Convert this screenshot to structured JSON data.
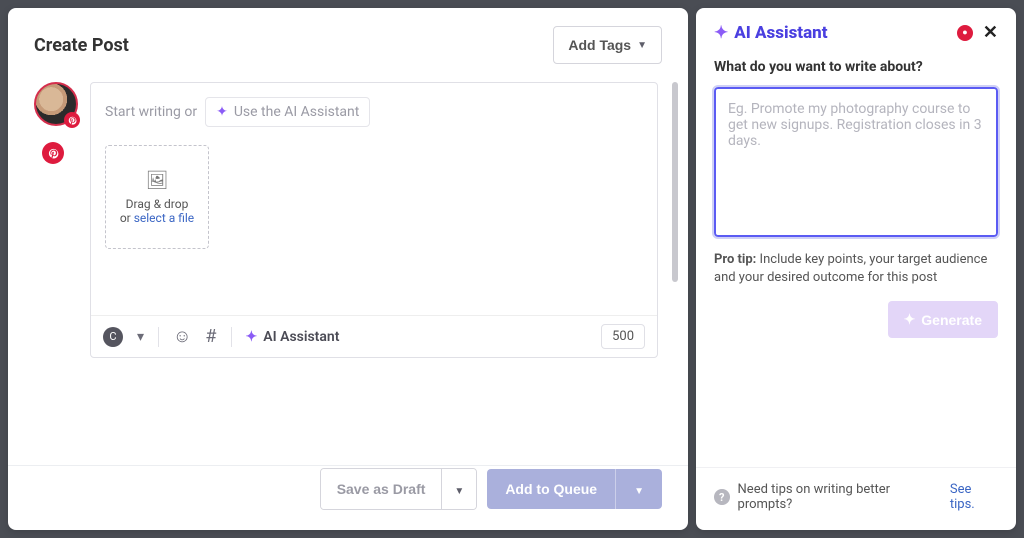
{
  "header": {
    "title": "Create Post",
    "add_tags": "Add Tags"
  },
  "composer": {
    "placeholder": "Start writing or",
    "ai_chip": "Use the AI Assistant",
    "drop_line1": "Drag & drop",
    "drop_line2_prefix": "or ",
    "drop_link": "select a file",
    "toolbar": {
      "ai_label": "AI Assistant",
      "char_limit": "500"
    }
  },
  "footer": {
    "save_draft": "Save as Draft",
    "add_queue": "Add to Queue"
  },
  "side": {
    "title": "AI Assistant",
    "question": "What do you want to write about?",
    "placeholder": "Eg. Promote my photography course to get new signups. Registration closes in 3 days.",
    "pro_tip_label": "Pro tip:",
    "pro_tip_text": " Include key points, your target audience and your desired outcome for this post",
    "generate": "Generate",
    "foot_text": "Need tips on writing better prompts? ",
    "foot_link": "See tips."
  }
}
